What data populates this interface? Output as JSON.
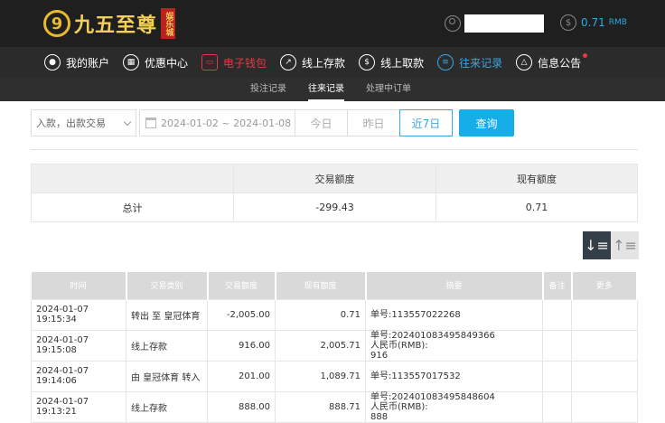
{
  "header": {
    "logo_text": "九五至尊",
    "logo_badge": "娱乐城",
    "balance": "0.71",
    "balance_unit": "RMB"
  },
  "nav": [
    {
      "label": "我的账户",
      "icon": "user-icon"
    },
    {
      "label": "优惠中心",
      "icon": "gift-icon"
    },
    {
      "label": "电子钱包",
      "icon": "wallet-icon"
    },
    {
      "label": "线上存款",
      "icon": "deposit-icon"
    },
    {
      "label": "线上取款",
      "icon": "withdraw-icon"
    },
    {
      "label": "往来记录",
      "icon": "records-icon"
    },
    {
      "label": "信息公告",
      "icon": "bell-icon"
    }
  ],
  "subnav": [
    "投注记录",
    "往来记录",
    "处理中订单"
  ],
  "filter": {
    "type_select": "入款，出款交易",
    "date_range": "2024-01-02 ~ 2024-01-08",
    "quick_buttons": [
      "今日",
      "昨日",
      "近7日"
    ],
    "search_label": "查询"
  },
  "summary": {
    "headers": [
      "",
      "交易额度",
      "现有额度"
    ],
    "row": {
      "label": "总计",
      "amount": "-299.43",
      "balance": "0.71"
    }
  },
  "table": {
    "headers": [
      "时间",
      "交易类别",
      "交易额度",
      "现有额度",
      "摘要",
      "备注",
      "更多"
    ],
    "rows": [
      {
        "time": "2024-01-07 19:15:34",
        "type": "转出 至 皇冠体育",
        "amount": "-2,005.00",
        "balance": "0.71",
        "memo": [
          "单号:113557022268"
        ]
      },
      {
        "time": "2024-01-07 19:15:08",
        "type": "线上存款",
        "amount": "916.00",
        "balance": "2,005.71",
        "memo": [
          "单号:202401083495849366",
          "人民币(RMB):",
          "916"
        ]
      },
      {
        "time": "2024-01-07 19:14:06",
        "type": "由 皇冠体育 转入",
        "amount": "201.00",
        "balance": "1,089.71",
        "memo": [
          "单号:113557017532"
        ]
      },
      {
        "time": "2024-01-07 19:13:21",
        "type": "线上存款",
        "amount": "888.00",
        "balance": "888.71",
        "memo": [
          "单号:202401083495848604",
          "人民币(RMB):",
          "888"
        ]
      }
    ]
  }
}
